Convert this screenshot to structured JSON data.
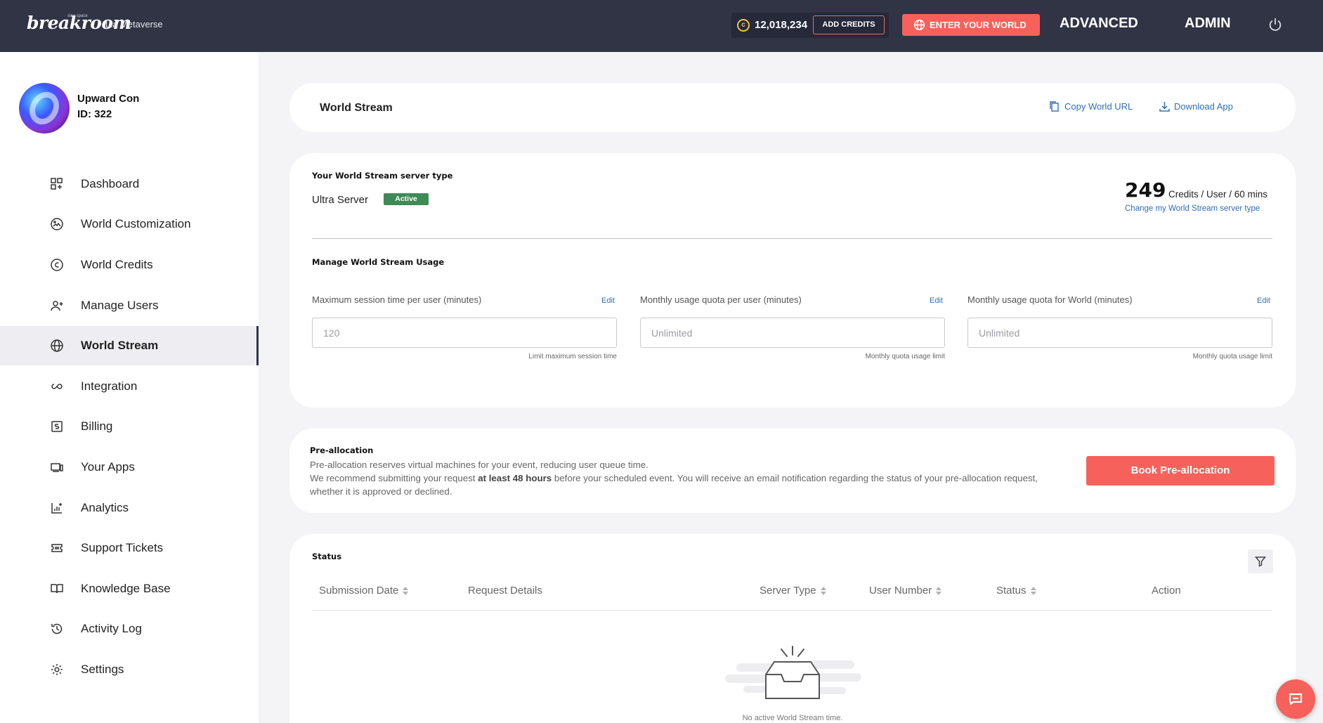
{
  "topbar": {
    "logo": "breakroom",
    "logo_sub": "sine space",
    "world_name": "Lia Metaverse",
    "credits": "12,018,234",
    "add_credits": "ADD CREDITS",
    "enter_world": "ENTER YOUR WORLD",
    "advanced": "ADVANCED",
    "admin": "ADMIN"
  },
  "profile": {
    "name": "Upward Con",
    "id": "ID: 322"
  },
  "sidebar": {
    "items": [
      {
        "label": "Dashboard",
        "icon": "dashboard-icon"
      },
      {
        "label": "World Customization",
        "icon": "palette-icon"
      },
      {
        "label": "World Credits",
        "icon": "credits-icon"
      },
      {
        "label": "Manage Users",
        "icon": "add-user-icon"
      },
      {
        "label": "World Stream",
        "icon": "globe-icon",
        "active": true
      },
      {
        "label": "Integration",
        "icon": "infinity-icon"
      },
      {
        "label": "Billing",
        "icon": "billing-icon"
      },
      {
        "label": "Your Apps",
        "icon": "devices-icon"
      },
      {
        "label": "Analytics",
        "icon": "analytics-icon"
      },
      {
        "label": "Support Tickets",
        "icon": "ticket-icon"
      },
      {
        "label": "Knowledge Base",
        "icon": "book-icon"
      },
      {
        "label": "Activity Log",
        "icon": "history-icon"
      },
      {
        "label": "Settings",
        "icon": "gear-icon"
      }
    ]
  },
  "header": {
    "title": "World Stream",
    "copy_url": "Copy World URL",
    "download_app": "Download App"
  },
  "server": {
    "heading": "Your World Stream server type",
    "name": "Ultra Server",
    "badge": "Active",
    "credits_value": "249",
    "credits_unit": "Credits / User / 60 mins",
    "change_link": "Change my World Stream server type"
  },
  "usage": {
    "heading": "Manage World Stream Usage",
    "fields": [
      {
        "label": "Maximum session time per user (minutes)",
        "edit": "Edit",
        "value": "120",
        "helper": "Limit maximum session time"
      },
      {
        "label": "Monthly usage quota per user (minutes)",
        "edit": "Edit",
        "value": "Unlimited",
        "helper": "Monthly quota usage limit"
      },
      {
        "label": "Monthly usage quota for World (minutes)",
        "edit": "Edit",
        "value": "Unlimited",
        "helper": "Monthly quota usage limit"
      }
    ]
  },
  "preallocation": {
    "heading": "Pre-allocation",
    "line1": "Pre-allocation reserves virtual machines for your event, reducing user queue time.",
    "line2_before": "We recommend submitting your request ",
    "line2_bold": "at least 48 hours",
    "line2_after": " before your scheduled event. You will receive an email notification regarding the status of your pre-allocation request, whether it is approved or declined.",
    "button": "Book Pre-allocation"
  },
  "status": {
    "heading": "Status",
    "columns": [
      "Submission Date",
      "Request Details",
      "Server Type",
      "User Number",
      "Status",
      "Action"
    ],
    "empty": "No active World Stream time."
  },
  "colors": {
    "topbar": "#303445",
    "accent": "#f7615b",
    "link": "#2f6fb6",
    "active_badge": "#3f8a57"
  }
}
